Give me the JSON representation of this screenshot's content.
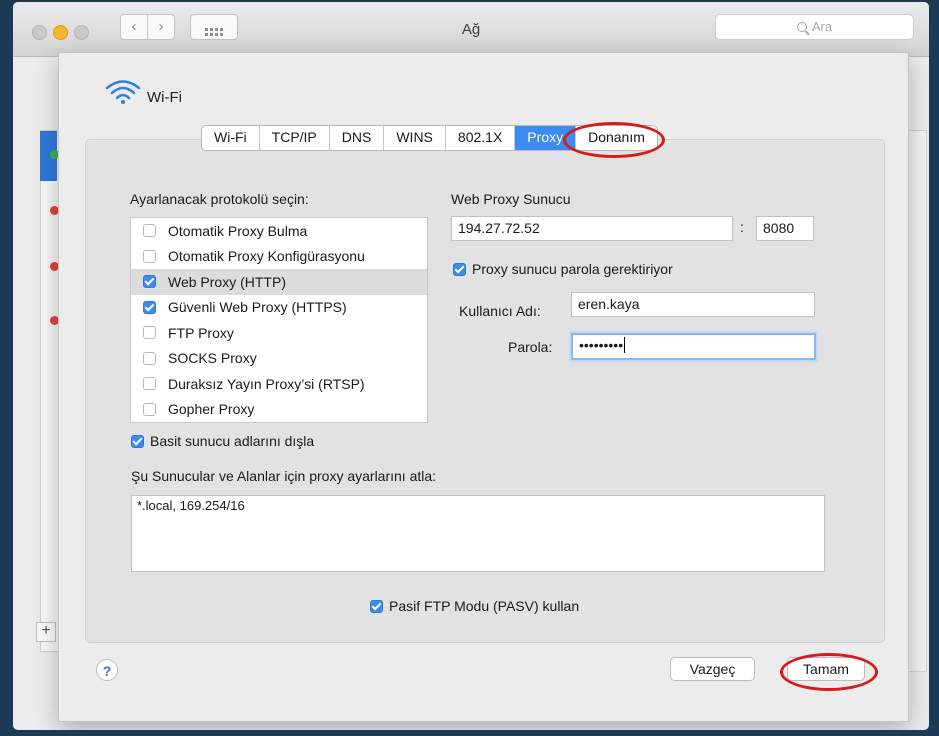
{
  "window": {
    "title": "Ağ",
    "search_placeholder": "Ara"
  },
  "header": {
    "interface_name": "Wi-Fi"
  },
  "tabs": [
    {
      "label": "Wi-Fi",
      "active": false
    },
    {
      "label": "TCP/IP",
      "active": false
    },
    {
      "label": "DNS",
      "active": false
    },
    {
      "label": "WINS",
      "active": false
    },
    {
      "label": "802.1X",
      "active": false
    },
    {
      "label": "Proxy",
      "active": true
    },
    {
      "label": "Donanım",
      "active": false
    }
  ],
  "protocols": {
    "heading": "Ayarlanacak protokolü seçin:",
    "items": [
      {
        "label": "Otomatik Proxy Bulma",
        "checked": false
      },
      {
        "label": "Otomatik Proxy Konfigürasyonu",
        "checked": false
      },
      {
        "label": "Web Proxy (HTTP)",
        "checked": true
      },
      {
        "label": "Güvenli Web Proxy (HTTPS)",
        "checked": true
      },
      {
        "label": "FTP Proxy",
        "checked": false
      },
      {
        "label": "SOCKS Proxy",
        "checked": false
      },
      {
        "label": "Duraksız Yayın Proxy’si (RTSP)",
        "checked": false
      },
      {
        "label": "Gopher Proxy",
        "checked": false
      }
    ]
  },
  "proxy_server": {
    "heading": "Web Proxy Sunucu",
    "host": "194.27.72.52",
    "separator": ":",
    "port": "8080",
    "requires_password_label": "Proxy sunucu parola gerektiriyor",
    "requires_password": true,
    "username_label": "Kullanıcı Adı:",
    "username": "eren.kaya",
    "password_label": "Parola:",
    "password_mask": "•••••••••"
  },
  "exclude_simple_label": "Basit sunucu adlarını dışla",
  "bypass": {
    "label": "Şu Sunucular ve Alanlar için proxy ayarlarını atla:",
    "value": "*.local, 169.254/16"
  },
  "pasv_label": "Pasif FTP Modu (PASV) kullan",
  "buttons": {
    "help": "?",
    "cancel": "Vazgeç",
    "ok": "Tamam"
  },
  "colors": {
    "accent": "#3b8bf0",
    "highlight_ring": "#d81a1a",
    "status_green": "#3fb34f",
    "status_red": "#e0443e"
  }
}
